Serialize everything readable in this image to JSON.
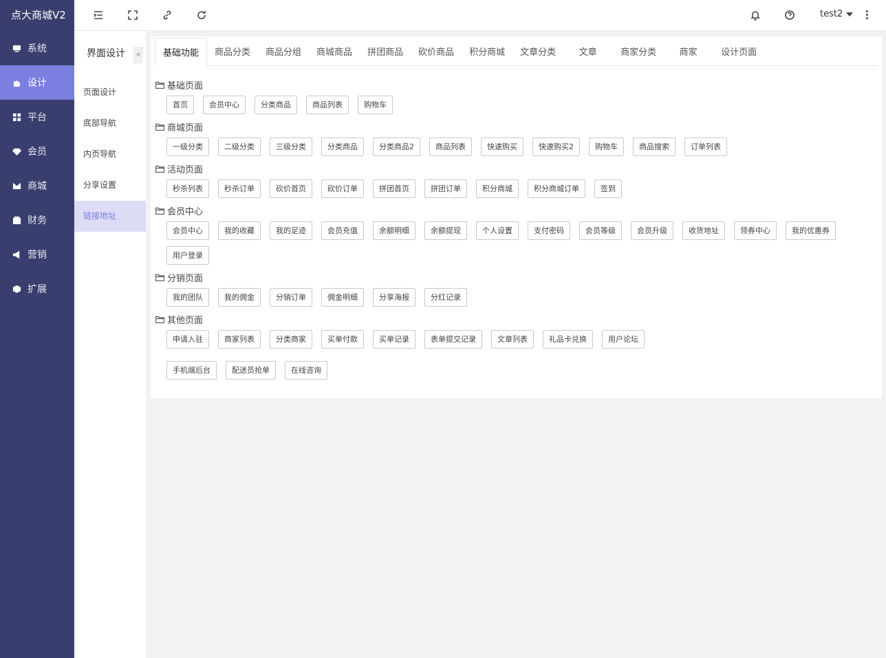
{
  "brand": "点大商城V2",
  "left_nav": [
    {
      "label": "系统",
      "icon": "monitor-icon"
    },
    {
      "label": "设计",
      "icon": "puzzle-icon",
      "active": true
    },
    {
      "label": "平台",
      "icon": "grid-icon"
    },
    {
      "label": "会员",
      "icon": "diamond-icon"
    },
    {
      "label": "商城",
      "icon": "mail-icon"
    },
    {
      "label": "财务",
      "icon": "wallet-icon"
    },
    {
      "label": "营销",
      "icon": "megaphone-icon"
    },
    {
      "label": "扩展",
      "icon": "cube-icon"
    }
  ],
  "topbar": {
    "user": "test2"
  },
  "subnav": {
    "title": "界面设计",
    "collapse": "«",
    "items": [
      "页面设计",
      "底部导航",
      "内页导航",
      "分享设置",
      "链接地址"
    ]
  },
  "tabs": [
    "基础功能",
    "商品分类",
    "商品分组",
    "商城商品",
    "拼团商品",
    "砍价商品",
    "积分商城",
    "文章分类",
    "文章",
    "商家分类",
    "商家",
    "设计页面"
  ],
  "sections": [
    {
      "title": "基础页面",
      "buttons": [
        "首页",
        "会员中心",
        "分类商品",
        "商品列表",
        "购物车"
      ]
    },
    {
      "title": "商城页面",
      "buttons": [
        "一级分类",
        "二级分类",
        "三级分类",
        "分类商品",
        "分类商品2",
        "商品列表",
        "快速购买",
        "快速购买2",
        "购物车",
        "商品搜索",
        "订单列表"
      ]
    },
    {
      "title": "活动页面",
      "buttons": [
        "秒杀列表",
        "秒杀订单",
        "砍价首页",
        "砍价订单",
        "拼团首页",
        "拼团订单",
        "积分商城",
        "积分商城订单",
        "签到"
      ]
    },
    {
      "title": "会员中心",
      "buttons": [
        "会员中心",
        "我的收藏",
        "我的足迹",
        "会员充值",
        "余额明细",
        "余额提现",
        "个人设置",
        "支付密码",
        "会员等级",
        "会员升级",
        "收货地址",
        "领券中心",
        "我的优惠券"
      ],
      "buttons2": [
        "用户登录"
      ]
    },
    {
      "title": "分销页面",
      "buttons": [
        "我的团队",
        "我的佣金",
        "分销订单",
        "佣金明细",
        "分享海报",
        "分红记录"
      ]
    },
    {
      "title": "其他页面",
      "buttons": [
        "申请入驻",
        "商家列表",
        "分类商家",
        "买单付款",
        "买单记录",
        "表单提交记录",
        "文章列表",
        "礼品卡兑换",
        "用户论坛"
      ],
      "buttons2": [
        "手机端后台",
        "配送员抢单",
        "在线咨询"
      ]
    }
  ]
}
